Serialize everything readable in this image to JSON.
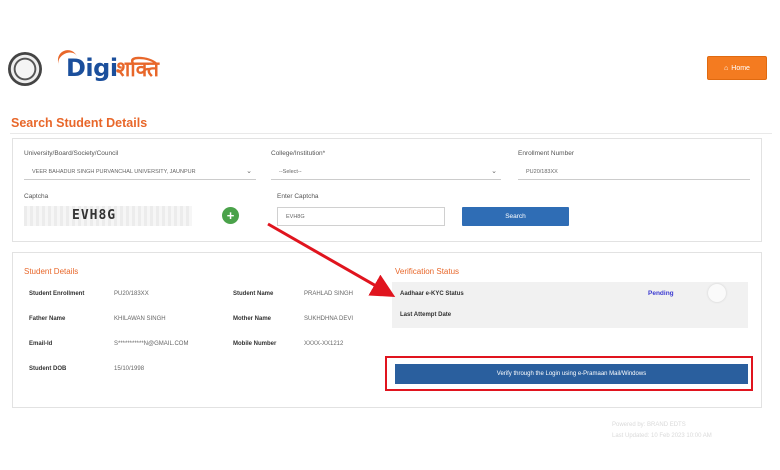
{
  "header": {
    "logo_primary": "Digi",
    "logo_secondary": "शक्ति",
    "logout_label": "Home"
  },
  "page_title": "Search Student Details",
  "search": {
    "university_label": "University/Board/Society/Council",
    "university_value": "VEER BAHADUR SINGH PURVANCHAL UNIVERSITY, JAUNPUR",
    "college_label": "College/Institution*",
    "college_value": "--Select--",
    "enrollment_label": "Enrollment Number",
    "enrollment_value": "PU20/183XX",
    "captcha_label": "Captcha",
    "captcha_text": "EVH8G",
    "enter_captcha_label": "Enter Captcha",
    "captcha_input_value": "EVH8G",
    "search_button": "Search"
  },
  "student": {
    "section_title": "Student Details",
    "fields": [
      {
        "label": "Student Enrollment",
        "value": "PU20/183XX"
      },
      {
        "label": "Student Name",
        "value": "PRAHLAD SINGH"
      },
      {
        "label": "Father Name",
        "value": "KHILAWAN SINGH"
      },
      {
        "label": "Mother Name",
        "value": "SUKHDHNA DEVI"
      },
      {
        "label": "Email-Id",
        "value": "S***********N@GMAIL.COM"
      },
      {
        "label": "Mobile Number",
        "value": "XXXX-XX1212"
      },
      {
        "label": "Student DOB",
        "value": "15/10/1998"
      }
    ]
  },
  "verification": {
    "section_title": "Verification Status",
    "aadhaar_label": "Aadhaar e-KYC Status",
    "aadhaar_status": "Pending",
    "last_attempt_label": "Last Attempt Date",
    "verify_button": "Verify through the Login using e-Pramaan Mail/Windows"
  },
  "footer": {
    "line1": "Powered by: BRAND EDTS",
    "line2": "Last Updated: 10 Feb 2023 10:00 AM"
  },
  "colors": {
    "accent_orange": "#e8672a",
    "primary_blue": "#2f6db5",
    "annotation_red": "#e0141e",
    "pending_blue": "#3b3ad1"
  }
}
